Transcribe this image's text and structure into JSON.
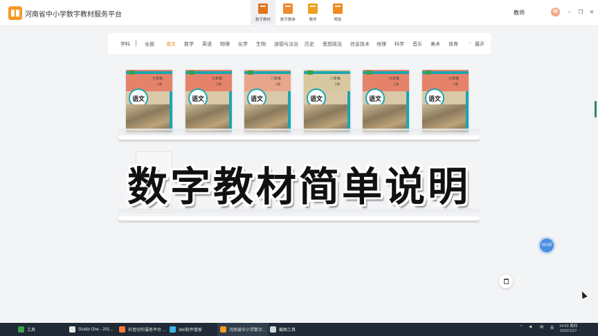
{
  "app": {
    "title": "河南省中小学数字教材服务平台"
  },
  "topnav": [
    {
      "label": "数字教材",
      "icon": "book-icon",
      "active": true
    },
    {
      "label": "数字教参",
      "icon": "reference-book-icon",
      "active": false
    },
    {
      "label": "教师",
      "icon": "teacher-icon",
      "active": false
    },
    {
      "label": "帮助",
      "icon": "help-icon",
      "active": false
    }
  ],
  "header": {
    "user_label": "教师",
    "minimize": "−",
    "restore": "❐",
    "close": "✕"
  },
  "subjects": {
    "label": "学科",
    "items": [
      "全部",
      "语文",
      "数学",
      "英语",
      "物理",
      "化学",
      "生物",
      "道德与法治",
      "历史",
      "思想政治",
      "信息技术",
      "地理",
      "科学",
      "音乐",
      "美术",
      "体育"
    ],
    "active": "语文",
    "expand_label": "展开"
  },
  "books": [
    {
      "grade": "七年级",
      "term": "上册",
      "title": "语文"
    },
    {
      "grade": "七年级",
      "term": "下册",
      "title": "语文"
    },
    {
      "grade": "八年级",
      "term": "上册",
      "title": "语文"
    },
    {
      "grade": "八年级",
      "term": "下册",
      "title": "语文"
    },
    {
      "grade": "九年级",
      "term": "上册",
      "title": "语文"
    },
    {
      "grade": "九年级",
      "term": "下册",
      "title": "语文"
    }
  ],
  "caption": "数字教材简单说明",
  "timer": "00:00",
  "taskbar": [
    {
      "label": "工具",
      "color": "#3aa047"
    },
    {
      "label": "Studio One - 201...",
      "color": "#e6e6e6"
    },
    {
      "label": "抖音创作服务平台 ...",
      "color": "#ff7a3c"
    },
    {
      "label": "360软件管家",
      "color": "#3cb5e6"
    },
    {
      "label": "河南省中小学数字...",
      "color": "#f59a23"
    },
    {
      "label": "截图工具",
      "color": "#cfd6dd"
    }
  ],
  "tray": {
    "lang": "英",
    "time": "14:02 周四",
    "date": "2022/1/27"
  }
}
